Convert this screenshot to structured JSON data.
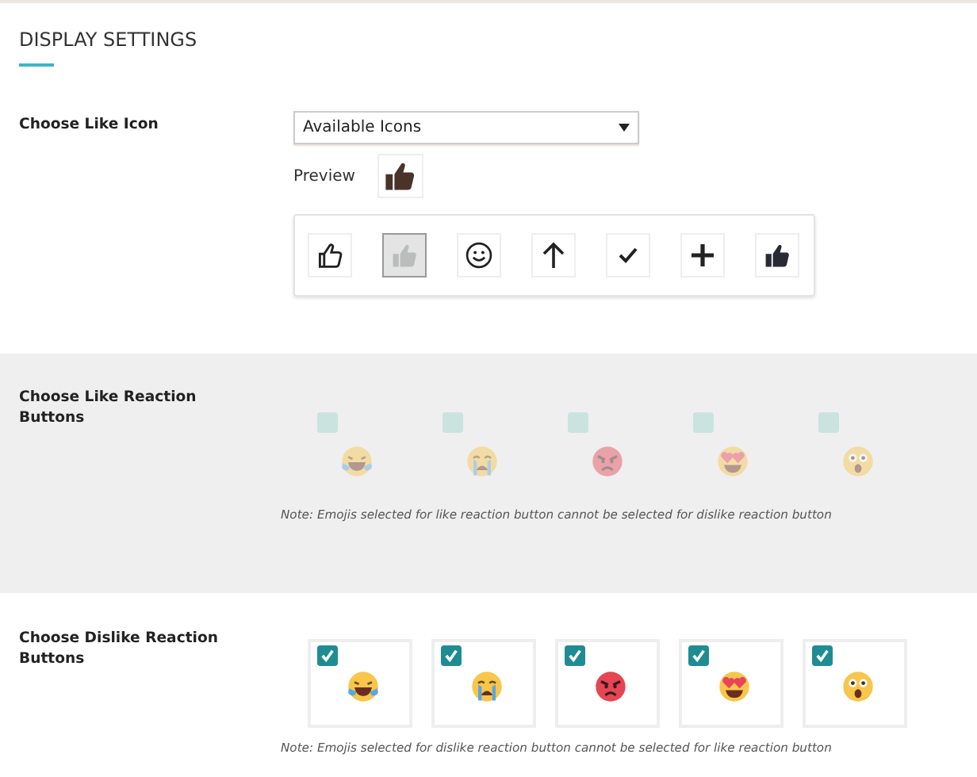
{
  "section_title": "DISPLAY SETTINGS",
  "like_icon": {
    "label": "Choose Like Icon",
    "select": {
      "value": "Available Icons"
    },
    "preview": {
      "label": "Preview",
      "kind": "thumb-solid-brown"
    },
    "options": [
      {
        "kind": "thumb-outline",
        "selected": false
      },
      {
        "kind": "thumb-solid-grey",
        "selected": true
      },
      {
        "kind": "smiley",
        "selected": false
      },
      {
        "kind": "arrow-up",
        "selected": false
      },
      {
        "kind": "check",
        "selected": false
      },
      {
        "kind": "plus",
        "selected": false
      },
      {
        "kind": "thumb-solid-dark",
        "selected": false
      }
    ]
  },
  "like_reactions": {
    "label": "Choose Like Reaction Buttons",
    "items": [
      {
        "kind": "laugh-tears",
        "checked": false,
        "disabled": true
      },
      {
        "kind": "crying",
        "checked": false,
        "disabled": true
      },
      {
        "kind": "angry",
        "checked": false,
        "disabled": true
      },
      {
        "kind": "heart-eyes",
        "checked": false,
        "disabled": true
      },
      {
        "kind": "surprised",
        "checked": false,
        "disabled": true
      }
    ],
    "note": "Note: Emojis selected for like reaction button cannot be selected for dislike reaction button"
  },
  "dislike_reactions": {
    "label": "Choose Dislike Reaction Buttons",
    "items": [
      {
        "kind": "laugh-tears",
        "checked": true,
        "disabled": false
      },
      {
        "kind": "crying",
        "checked": true,
        "disabled": false
      },
      {
        "kind": "angry",
        "checked": true,
        "disabled": false
      },
      {
        "kind": "heart-eyes",
        "checked": true,
        "disabled": false
      },
      {
        "kind": "surprised",
        "checked": true,
        "disabled": false
      }
    ],
    "note": "Note: Emojis selected for dislike reaction button cannot be selected for like reaction button"
  }
}
